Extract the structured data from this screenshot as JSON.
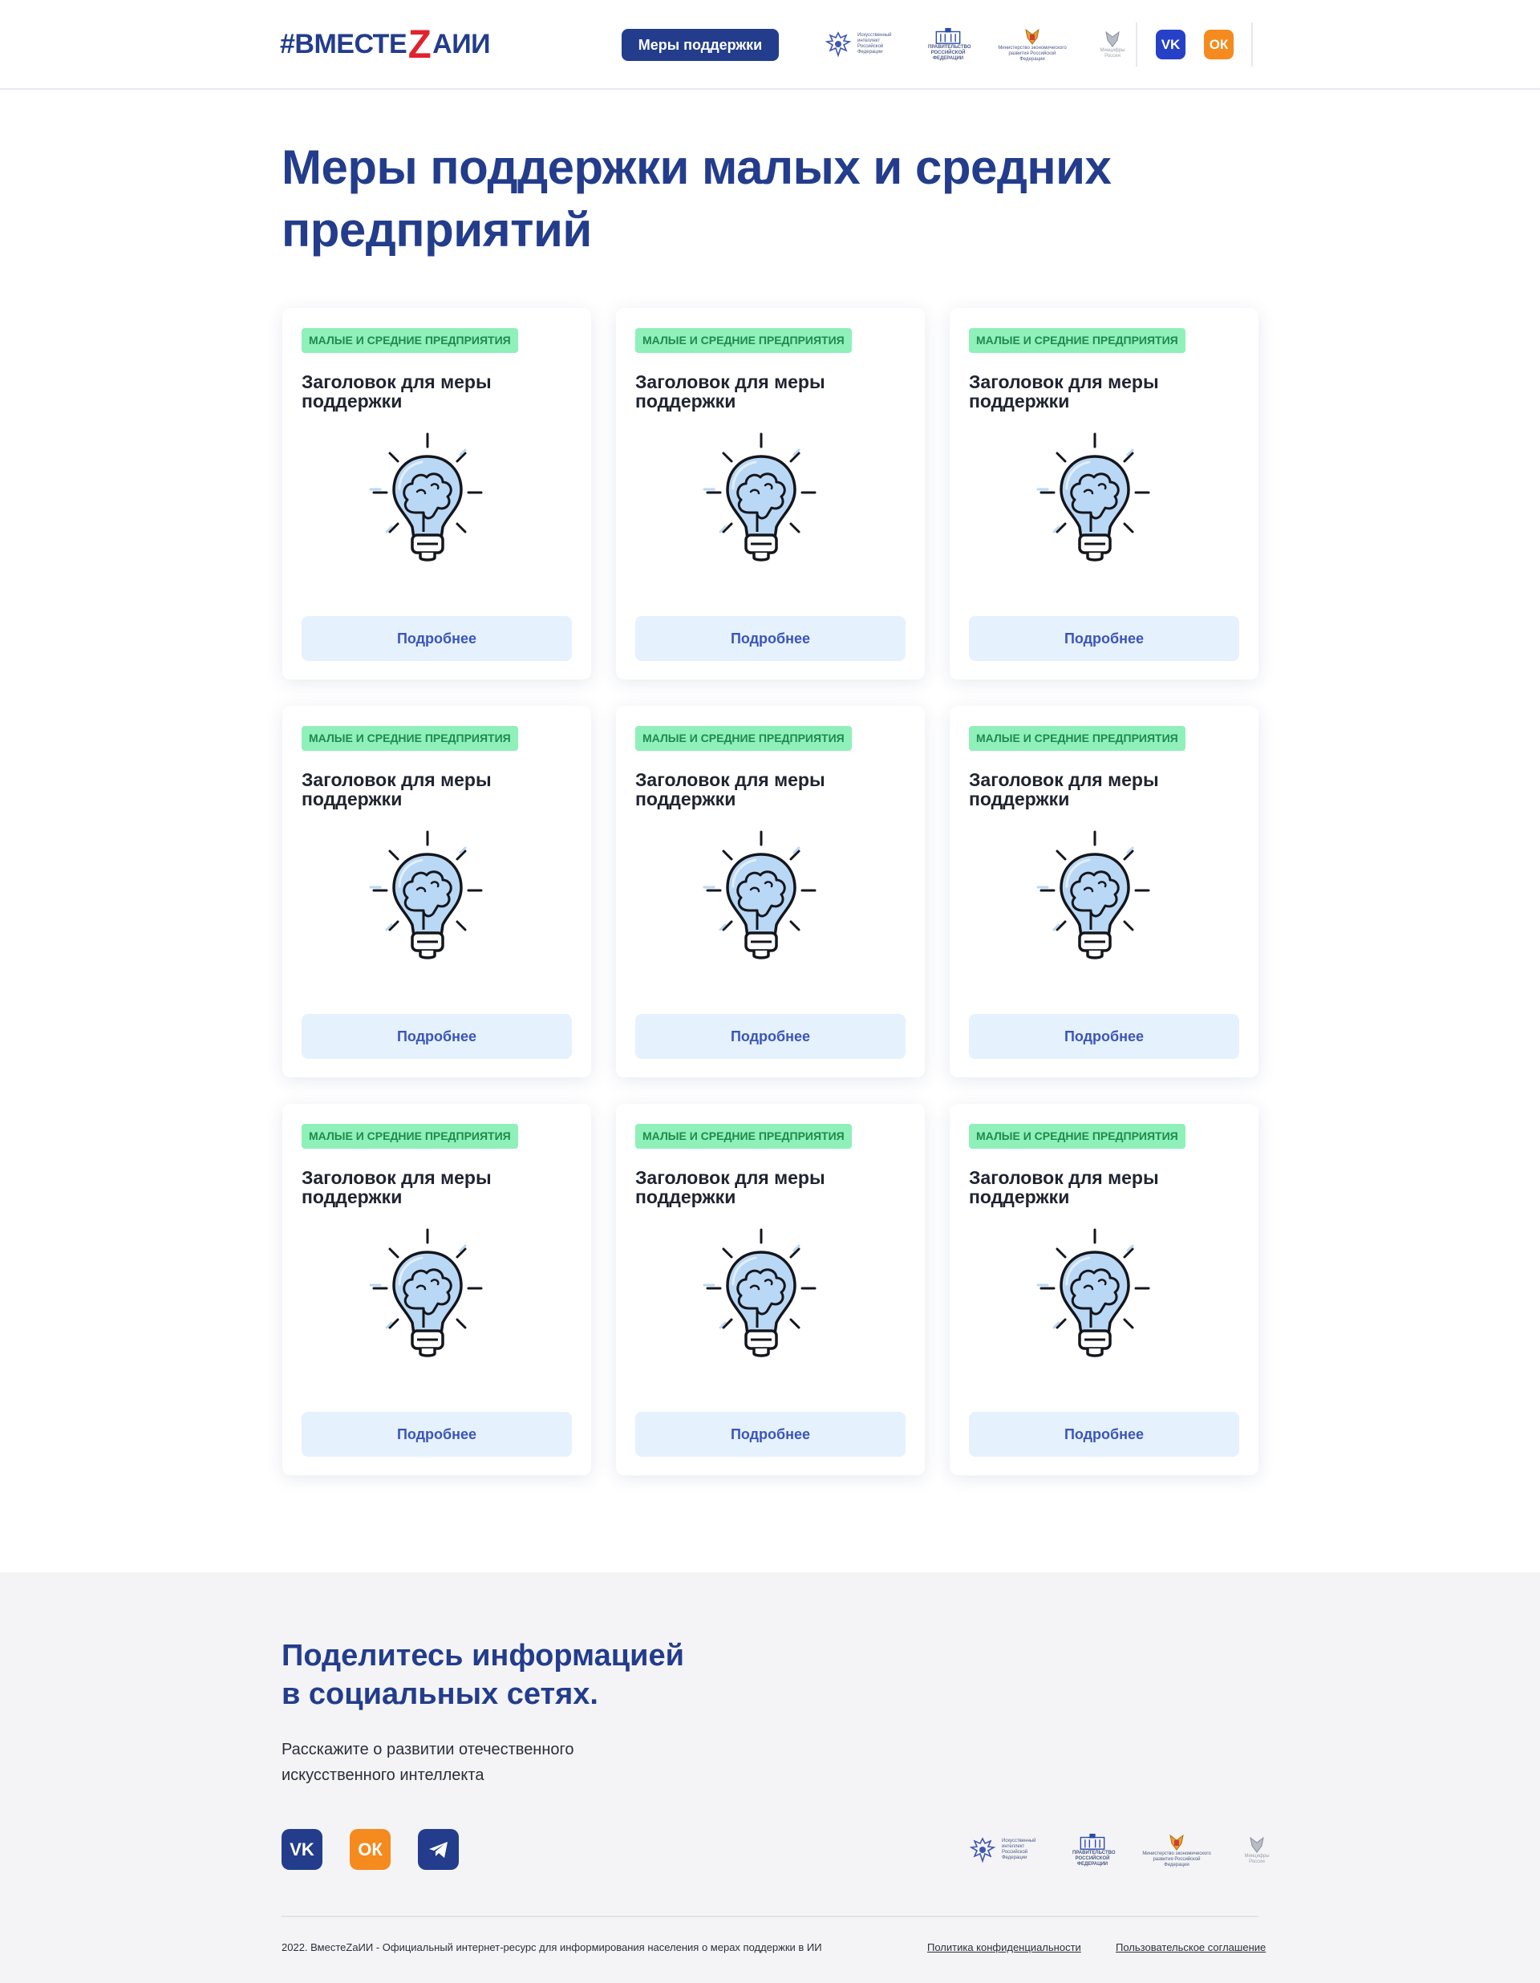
{
  "header": {
    "logo_prefix": "#ВМЕСТЕ",
    "logo_z": "Z",
    "logo_suffix": "АИИ",
    "measures_button": "Меры поддержки",
    "partners": [
      {
        "icon": "eagle-emblem-icon",
        "text": "Искусственный интеллект Российской Федерации"
      },
      {
        "icon": "government-building-icon",
        "text": "ПРАВИТЕЛЬСТВО РОССИЙСКОЙ ФЕДЕРАЦИИ"
      },
      {
        "icon": "coat-of-arms-icon",
        "text": "Министерство экономического развития Российской Федерации"
      },
      {
        "icon": "coat-of-arms-gray-icon",
        "text": "Минцифры России"
      }
    ],
    "social": [
      {
        "icon": "vk-icon",
        "label": "VK"
      },
      {
        "icon": "odnoklassniki-icon",
        "label": "ОК"
      }
    ]
  },
  "page": {
    "title": "Меры поддержки малых и средних предприятий"
  },
  "cards": [
    {
      "badge": "МАЛЫЕ И СРЕДНИЕ ПРЕДПРИЯТИЯ",
      "title": "Заголовок для меры поддержки",
      "button": "Подробнее",
      "icon": "lightbulb-brain-icon"
    },
    {
      "badge": "МАЛЫЕ И СРЕДНИЕ ПРЕДПРИЯТИЯ",
      "title": "Заголовок для меры поддержки",
      "button": "Подробнее",
      "icon": "lightbulb-brain-icon"
    },
    {
      "badge": "МАЛЫЕ И СРЕДНИЕ ПРЕДПРИЯТИЯ",
      "title": "Заголовок для меры поддержки",
      "button": "Подробнее",
      "icon": "lightbulb-brain-icon"
    },
    {
      "badge": "МАЛЫЕ И СРЕДНИЕ ПРЕДПРИЯТИЯ",
      "title": "Заголовок для меры поддержки",
      "button": "Подробнее",
      "icon": "lightbulb-brain-icon"
    },
    {
      "badge": "МАЛЫЕ И СРЕДНИЕ ПРЕДПРИЯТИЯ",
      "title": "Заголовок для меры поддержки",
      "button": "Подробнее",
      "icon": "lightbulb-brain-icon"
    },
    {
      "badge": "МАЛЫЕ И СРЕДНИЕ ПРЕДПРИЯТИЯ",
      "title": "Заголовок для меры поддержки",
      "button": "Подробнее",
      "icon": "lightbulb-brain-icon"
    },
    {
      "badge": "МАЛЫЕ И СРЕДНИЕ ПРЕДПРИЯТИЯ",
      "title": "Заголовок для меры поддержки",
      "button": "Подробнее",
      "icon": "lightbulb-brain-icon"
    },
    {
      "badge": "МАЛЫЕ И СРЕДНИЕ ПРЕДПРИЯТИЯ",
      "title": "Заголовок для меры поддержки",
      "button": "Подробнее",
      "icon": "lightbulb-brain-icon"
    },
    {
      "badge": "МАЛЫЕ И СРЕДНИЕ ПРЕДПРИЯТИЯ",
      "title": "Заголовок для меры поддержки",
      "button": "Подробнее",
      "icon": "lightbulb-brain-icon"
    }
  ],
  "footer": {
    "share_title_line1": "Поделитесь информацией",
    "share_title_line2": "в социальных сетях.",
    "share_desc_line1": "Расскажите о развитии отечественного",
    "share_desc_line2": "искусственного интеллекта",
    "social": [
      {
        "icon": "vk-icon",
        "label": "VK"
      },
      {
        "icon": "odnoklassniki-icon",
        "label": "ОК"
      },
      {
        "icon": "telegram-icon",
        "label": ""
      }
    ],
    "copyright": "2022. ВместеZаИИ - Официальный интернет-ресурс для информирования населения о мерах поддержки в ИИ",
    "privacy_link": "Политика конфиденциальности",
    "terms_link": "Пользовательское соглашение"
  },
  "colors": {
    "brand_blue": "#233d8c",
    "brand_red": "#e0242e",
    "badge_green_bg": "#8ff0b9",
    "badge_green_text": "#1f8a4f",
    "button_light": "#e6f1fe",
    "vk": "#2641c7",
    "ok": "#f58a1f"
  }
}
